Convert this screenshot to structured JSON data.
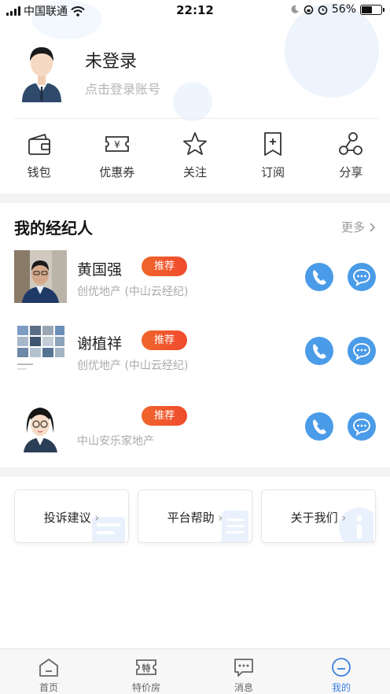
{
  "status": {
    "carrier": "中国联通",
    "time": "22:12",
    "battery": "56%",
    "battery_level": 0.56
  },
  "profile": {
    "name": "未登录",
    "login_hint": "点击登录账号"
  },
  "quick_actions": [
    {
      "label": "钱包",
      "icon": "wallet-icon"
    },
    {
      "label": "优惠券",
      "icon": "coupon-icon"
    },
    {
      "label": "关注",
      "icon": "star-icon"
    },
    {
      "label": "订阅",
      "icon": "bookmark-icon"
    },
    {
      "label": "分享",
      "icon": "share-icon"
    }
  ],
  "agents_section": {
    "title": "我的经纪人",
    "more": "更多"
  },
  "agents": [
    {
      "name": "黄国强",
      "badge": "推荐",
      "company": "创优地产 (中山云经纪)"
    },
    {
      "name": "谢植祥",
      "badge": "推荐",
      "company": "创优地产 (中山云经纪)"
    },
    {
      "name": "",
      "badge": "推荐",
      "company": "中山安乐家地产"
    }
  ],
  "cards": [
    {
      "label": "投诉建议"
    },
    {
      "label": "平台帮助"
    },
    {
      "label": "关于我们"
    }
  ],
  "tabs": [
    {
      "label": "首页",
      "icon": "home-icon"
    },
    {
      "label": "特价房",
      "icon": "special-price-icon"
    },
    {
      "label": "消息",
      "icon": "message-icon"
    },
    {
      "label": "我的",
      "icon": "profile-icon"
    }
  ],
  "colors": {
    "accent": "#3a7fe0",
    "badge": "#f0552c",
    "circle_button": "#4a9be8"
  }
}
